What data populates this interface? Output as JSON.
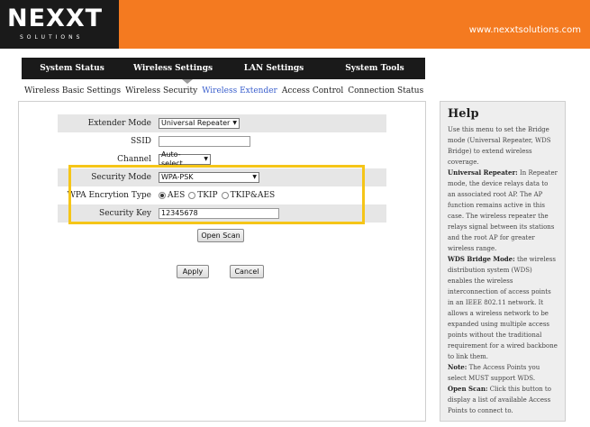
{
  "header": {
    "logo_text": "NEXXT",
    "logo_sub": "SOLUTIONS",
    "site_url": "www.nexxtsolutions.com",
    "brand_color": "#f47a20"
  },
  "main_nav": {
    "items": [
      {
        "label": "System Status"
      },
      {
        "label": "Wireless Settings"
      },
      {
        "label": "LAN Settings"
      },
      {
        "label": "System Tools"
      }
    ],
    "active_index": 1
  },
  "sub_nav": {
    "items": [
      {
        "label": "Wireless Basic Settings"
      },
      {
        "label": "Wireless Security"
      },
      {
        "label": "Wireless Extender",
        "active": true
      },
      {
        "label": "Access Control"
      },
      {
        "label": "Connection Status"
      }
    ]
  },
  "form": {
    "extender_mode": {
      "label": "Extender Mode",
      "value": "Universal Repeater"
    },
    "ssid": {
      "label": "SSID",
      "value": ""
    },
    "channel": {
      "label": "Channel",
      "value": "Auto-select"
    },
    "security_mode": {
      "label": "Security Mode",
      "value": "WPA-PSK"
    },
    "wpa_encryption": {
      "label": "WPA Encrytion Type",
      "options": [
        "AES",
        "TKIP",
        "TKIP&AES"
      ],
      "selected": "AES"
    },
    "security_key": {
      "label": "Security Key",
      "value": "12345678"
    },
    "open_scan_label": "Open Scan",
    "apply_label": "Apply",
    "cancel_label": "Cancel",
    "highlight_color": "#f5c518"
  },
  "help": {
    "title": "Help",
    "intro": "Use this menu to set the Bridge mode (Universal Repeater, WDS Bridge) to extend wireless coverage.",
    "repeater_term": "Universal Repeater:",
    "repeater_text": " In Repeater mode, the device relays data to an associated root AP. The AP function remains active in this case. The wireless repeater the relays signal between its stations and the root AP for greater wireless range.",
    "wds_term": "WDS Bridge Mode:",
    "wds_text": " the wireless distribution system (WDS) enables the wireless interconnection of access points in an IEEE 802.11 network. It allows a wireless network to be expanded using multiple access points without the traditional requirement for a wired backbone to link them.",
    "note_term": "Note:",
    "note_text": " The Access Points you select MUST support WDS.",
    "scan_term": "Open Scan:",
    "scan_text": " Click this button to display a list of available Access Points to connect to."
  }
}
